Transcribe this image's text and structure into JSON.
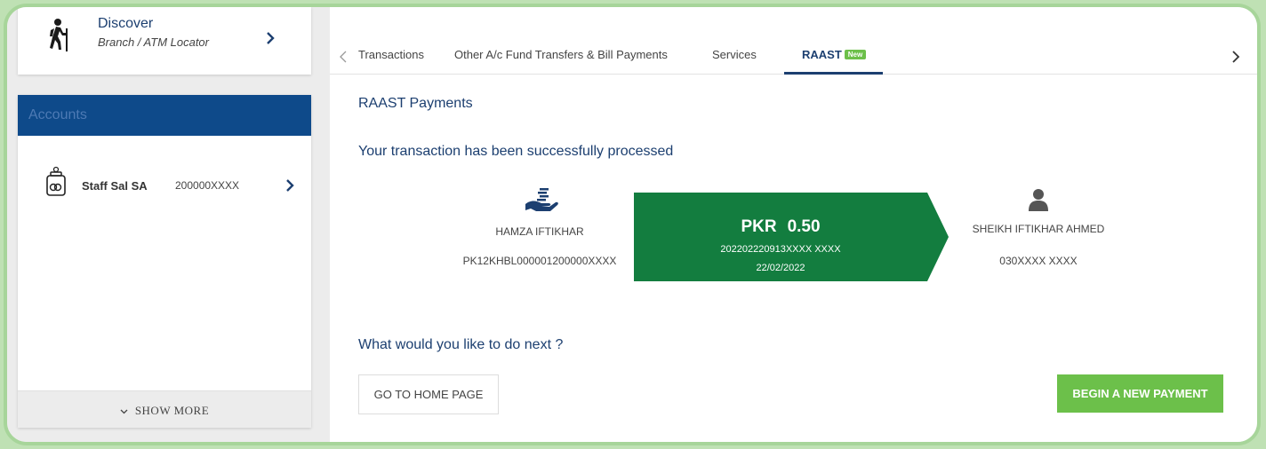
{
  "colors": {
    "brand_navy": "#1c3f70",
    "accent_green": "#6cc04a",
    "amount_green": "#137d3f",
    "accounts_header": "#0e4a8a"
  },
  "discover": {
    "title": "Discover",
    "subtitle": "Branch / ATM Locator",
    "icon": "hiker-icon"
  },
  "accounts": {
    "header": "Accounts",
    "items": [
      {
        "name": "Staff Sal SA",
        "number": "200000XXXX",
        "icon": "money-jar-icon"
      }
    ],
    "show_more": "SHOW MORE"
  },
  "tabs": [
    {
      "label": "Transactions"
    },
    {
      "label": "Other A/c Fund Transfers & Bill Payments"
    },
    {
      "label": "Services"
    },
    {
      "label": "RAAST",
      "badge": "New",
      "active": true
    }
  ],
  "page": {
    "title": "RAAST Payments",
    "success_message": "Your transaction has been successfully processed"
  },
  "sender": {
    "name": "HAMZA IFTIKHAR",
    "iban": "PK12KHBL000001200000XXXX",
    "icon": "hand-coins-icon"
  },
  "transaction": {
    "currency": "PKR",
    "amount": "0.50",
    "id": "202202220913XXXX XXXX",
    "date": "22/02/2022"
  },
  "receiver": {
    "name": "SHEIKH IFTIKHAR AHMED",
    "number": "030XXXX XXXX",
    "icon": "user-icon"
  },
  "next": {
    "question": "What would you like to do next ?",
    "home_button": "GO TO HOME PAGE",
    "new_payment_button": "BEGIN A NEW PAYMENT"
  }
}
